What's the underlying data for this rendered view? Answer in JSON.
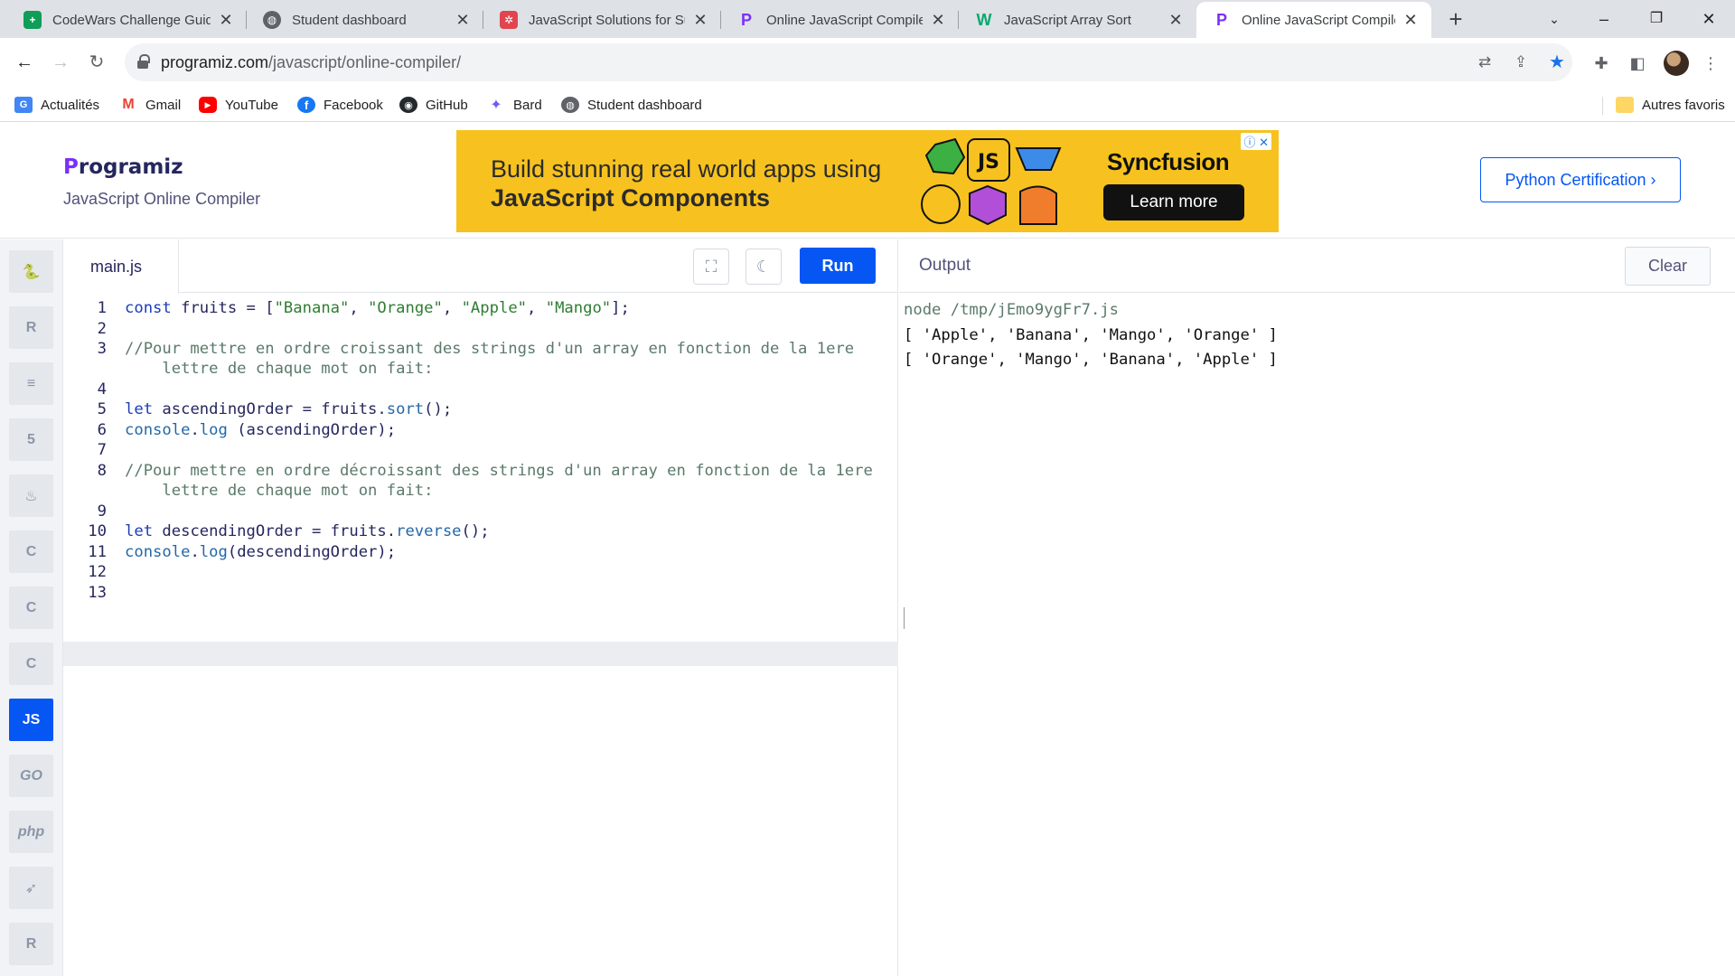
{
  "browser": {
    "tabs": [
      {
        "title": "CodeWars Challenge Guide",
        "icon": "sheets-icon"
      },
      {
        "title": "Student dashboard",
        "icon": "globe-icon"
      },
      {
        "title": "JavaScript Solutions for Sum",
        "icon": "openai-icon"
      },
      {
        "title": "Online JavaScript Compiler",
        "icon": "programiz-icon"
      },
      {
        "title": "JavaScript Array Sort",
        "icon": "w3schools-icon"
      },
      {
        "title": "Online JavaScript Compiler",
        "icon": "programiz-icon",
        "active": true
      }
    ],
    "url_host": "programiz.com",
    "url_path": "/javascript/online-compiler/",
    "bookmarks": [
      {
        "label": "Actualités",
        "icon": "news-icon"
      },
      {
        "label": "Gmail",
        "icon": "gmail-icon"
      },
      {
        "label": "YouTube",
        "icon": "youtube-icon"
      },
      {
        "label": "Facebook",
        "icon": "facebook-icon"
      },
      {
        "label": "GitHub",
        "icon": "github-icon"
      },
      {
        "label": "Bard",
        "icon": "bard-icon"
      },
      {
        "label": "Student dashboard",
        "icon": "globe-icon"
      }
    ],
    "other_bookmarks": "Autres favoris"
  },
  "site": {
    "logo": "rogramiz",
    "logo_p": "P",
    "subtitle": "JavaScript Online Compiler",
    "ad": {
      "line1": "Build stunning real world apps using",
      "line2": "JavaScript Components",
      "brand": "Syncfusion",
      "button": "Learn more",
      "hex_label": "JS"
    },
    "cert_button": "Python Certification ›"
  },
  "sidebar_langs": [
    {
      "name": "python",
      "glyph": "🐍"
    },
    {
      "name": "r",
      "glyph": "R"
    },
    {
      "name": "sql",
      "glyph": "≡"
    },
    {
      "name": "html",
      "glyph": "5"
    },
    {
      "name": "java",
      "glyph": "♨"
    },
    {
      "name": "c",
      "glyph": "C"
    },
    {
      "name": "cpp",
      "glyph": "C"
    },
    {
      "name": "csharp",
      "glyph": "C"
    },
    {
      "name": "js",
      "glyph": "JS",
      "active": true
    },
    {
      "name": "go",
      "glyph": "GO"
    },
    {
      "name": "php",
      "glyph": "php"
    },
    {
      "name": "swift",
      "glyph": "➶"
    },
    {
      "name": "rust",
      "glyph": "R"
    }
  ],
  "editor": {
    "file_name": "main.js",
    "run_label": "Run",
    "lines": [
      {
        "n": "1"
      },
      {
        "n": "2"
      },
      {
        "n": "3"
      },
      {
        "n": "4"
      },
      {
        "n": "5"
      },
      {
        "n": "6"
      },
      {
        "n": "7"
      },
      {
        "n": "8"
      },
      {
        "n": "9"
      },
      {
        "n": "10"
      },
      {
        "n": "11"
      },
      {
        "n": "12"
      },
      {
        "n": "13"
      }
    ],
    "code": {
      "l1_kw": "const",
      "l1_a": " fruits = [",
      "l1_s1": "\"Banana\"",
      "l1_c1": ", ",
      "l1_s2": "\"Orange\"",
      "l1_c2": ", ",
      "l1_s3": "\"Apple\"",
      "l1_c3": ", ",
      "l1_s4": "\"Mango\"",
      "l1_end": "];",
      "l3a": "//Pour mettre en ordre croissant des strings d'un array en fonction de la 1ere",
      "l3b": "    lettre de chaque mot on fait:",
      "l5_kw": "let",
      "l5_a": " ascendingOrder = fruits.",
      "l5_fn": "sort",
      "l5_end": "();",
      "l6_fn": "console",
      "l6_a": ".",
      "l6_fn2": "log",
      "l6_end": " (ascendingOrder);",
      "l8a": "//Pour mettre en ordre décroissant des strings d'un array en fonction de la 1ere",
      "l8b": "    lettre de chaque mot on fait:",
      "l10_kw": "let",
      "l10_a": " descendingOrder = fruits.",
      "l10_fn": "reverse",
      "l10_end": "();",
      "l11_fn": "console",
      "l11_a": ".",
      "l11_fn2": "log",
      "l11_end": "(descendingOrder);"
    }
  },
  "output": {
    "title": "Output",
    "clear_label": "Clear",
    "lines": [
      "node /tmp/jEmo9ygFr7.js",
      "[ 'Apple', 'Banana', 'Mango', 'Orange' ]",
      "[ 'Orange', 'Mango', 'Banana', 'Apple' ]"
    ]
  },
  "colors": {
    "accent": "#0556f3",
    "ad_background": "#f7c21f",
    "brand_purple": "#7b2ff7"
  }
}
